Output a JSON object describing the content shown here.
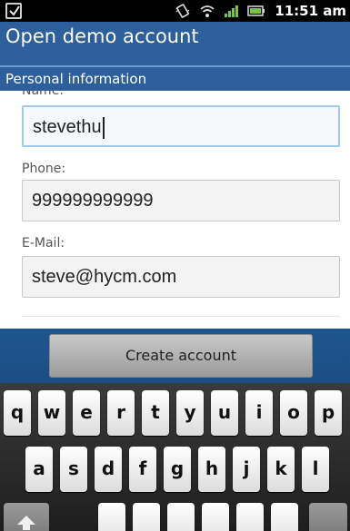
{
  "status_bar": {
    "time": "11:51 am",
    "icons": [
      "checkbox-notification-icon",
      "vibrate-icon",
      "wifi-icon",
      "signal-icon",
      "battery-icon"
    ]
  },
  "header": {
    "title": "Open demo account",
    "subtitle": "Personal information"
  },
  "form": {
    "name_label": "Name:",
    "name_value": "stevethu",
    "phone_label": "Phone:",
    "phone_value": "999999999999",
    "email_label": "E-Mail:",
    "email_value": "steve@hycm.com"
  },
  "actions": {
    "create_label": "Create account"
  },
  "keyboard": {
    "row1": [
      "q",
      "w",
      "e",
      "r",
      "t",
      "y",
      "u",
      "i",
      "o",
      "p"
    ],
    "row2": [
      "a",
      "s",
      "d",
      "f",
      "g",
      "h",
      "j",
      "k",
      "l"
    ]
  },
  "colors": {
    "title_bar": "#2c5f9b",
    "button_area": "#1f5690",
    "focus_border": "#9ecae8"
  }
}
